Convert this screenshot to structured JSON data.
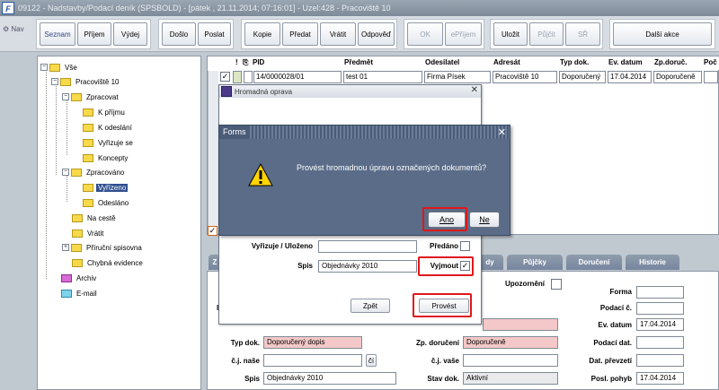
{
  "window": {
    "title": "09122 - Nadstavby/Podací deník (SPSBOLD) - [pátek , 21.11.2014; 07:16:01] - Uzel:428 - Pracoviště 10"
  },
  "toolbar": {
    "nav": "Nav",
    "buttons": {
      "seznam": "Seznam",
      "prijem": "Příjem",
      "vydej": "Výdej",
      "doslo": "Došlo",
      "poslat": "Poslat",
      "kopie": "Kopie",
      "predat": "Předat",
      "vratit": "Vrátit",
      "odpoved": "Odpověď",
      "ok": "OK",
      "eprijem": "ePříjem",
      "ulozit": "Uložit",
      "pujcit": "Půjčit",
      "sr": "SŘ",
      "dalsi_akce": "Další akce"
    }
  },
  "tree": {
    "all": "Vše",
    "pracoviste": "Pracoviště 10",
    "zpracovat": "Zpracovat",
    "k_prijmu": "K příjmu",
    "k_odeslani": "K odeslání",
    "vyrizuje_se": "Vyřizuje se",
    "koncepty": "Koncepty",
    "zpracovano": "Zpracováno",
    "vyrizeno": "Vyřízeno",
    "odeslano": "Odesláno",
    "na_ceste": "Na cestě",
    "vratit": "Vrátit",
    "prirucni_spisovna": "Příruční spisovna",
    "chybna_evidence": "Chybná evidence",
    "archiv": "Archiv",
    "email": "E-mail"
  },
  "grid": {
    "headers": {
      "excl": "!",
      "pid": "PID",
      "predmet": "Předmět",
      "odesilatel": "Odesilatel",
      "adresat": "Adresát",
      "typ_dok": "Typ dok.",
      "ev_datum": "Ev. datum",
      "zp_doruc": "Zp.doruč.",
      "poc": "Poč"
    },
    "row": {
      "check": "✓",
      "pid": "14/0000028/01",
      "predmet": "test 01",
      "odesilatel": "Firma Písek",
      "adresat": "Pracoviště 10",
      "typ_dok": "Doporučený",
      "ev_datum": "17.04.2014",
      "zp_doruc": "Doporučeně"
    }
  },
  "hromadna": {
    "title": "Hromadná oprava",
    "vyrizuje_label": "Vyřizuje / Uloženo",
    "predano_label": "Předáno",
    "spis_label": "Spis",
    "spis_value": "Objednávky 2010",
    "vyjmout_label": "Vyjmout",
    "vyjmout_check": "✓",
    "zpet": "Zpět",
    "provest": "Provést"
  },
  "forms_dialog": {
    "title": "Forms",
    "message": "Provést hromadnou úpravu označených dokumentů?",
    "ano": "Ano",
    "ne": "Ne"
  },
  "tabs": {
    "z": "Z",
    "dy": "dy",
    "pujcky": "Půjčky",
    "doruceni": "Doručení",
    "historie": "Historie"
  },
  "detail": {
    "upozorneni": "Upozornění",
    "forma": "Forma",
    "podaci_c": "Podací č.",
    "ev_datum": "Ev. datum",
    "ev_datum_value": "17.04.2014",
    "typ_dok": "Typ dok.",
    "typ_dok_value": "Doporučený dopis",
    "zp_doruceni": "Zp. doručení",
    "zp_doruceni_value": "Doporučeně",
    "podaci_dat": "Podací dat.",
    "cj_nase": "č.j. naše",
    "cj_btn": "čí",
    "cj_vase": "č.j. vaše",
    "dat_prevzeti": "Dat. převzetí",
    "spis": "Spis",
    "spis_value": "Objednávky 2010",
    "stav_dok": "Stav dok.",
    "stav_dok_value": "Aktivní",
    "posl_pohyb": "Posl. pohyb",
    "posl_pohyb_value": "17.04.2014",
    "left_marker": "I"
  },
  "colors": {
    "highlight": "#e01818",
    "selected": "#2f4f8f",
    "dialog": "#5a6c88",
    "pink": "#f4c8c8"
  }
}
